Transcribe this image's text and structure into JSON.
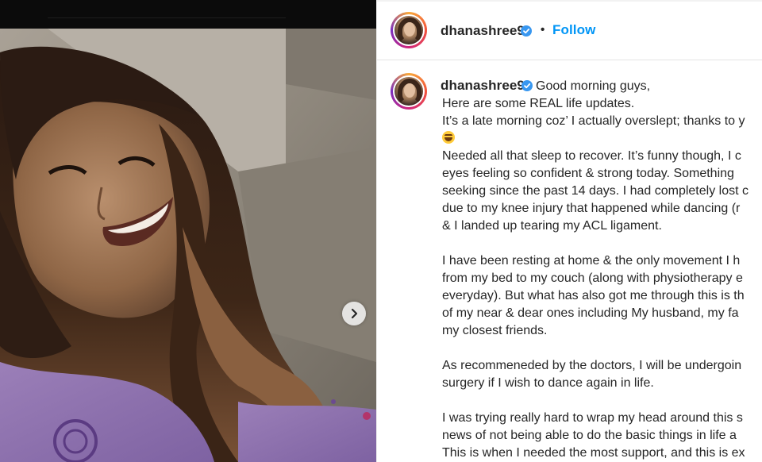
{
  "post": {
    "username": "dhanashree9",
    "verified": true,
    "separator": "•",
    "follow_label": "Follow",
    "next_icon": "chevron-right-icon",
    "photo_alt": "selfie photo"
  },
  "caption": {
    "username": "dhanashree9",
    "lines": [
      "Good morning guys,",
      "Here are some REAL life updates.",
      "It’s a late morning coz’ I actually overslept; thanks to y",
      "",
      "Needed all that sleep to recover. It’s funny though, I c",
      "eyes feeling so confident & strong today. Something",
      "seeking since the past 14 days. I had completely lost c",
      "due to my knee injury that happened while dancing (r",
      "& I landed up tearing my ACL ligament.",
      "",
      "I have been resting at home & the only movement I h",
      "from my bed to my couch (along with physiotherapy e",
      "everyday). But what has also got me through this is th",
      "of my near & dear ones including My husband, my fa",
      "my closest friends.",
      "",
      "As recommeneded by the doctors, I will be undergoin",
      "surgery if I wish to dance again in life.",
      "",
      "I was trying really hard to wrap my head around this s",
      "news of not being able to do the basic things in life a",
      "This is when I needed the most support, and this is ex"
    ],
    "emoji_line_index": 3,
    "emoji_icon": "laughing-face-emoji"
  },
  "colors": {
    "accent_blue": "#0095f6",
    "verified_blue": "#3897f0",
    "text": "#262626"
  }
}
